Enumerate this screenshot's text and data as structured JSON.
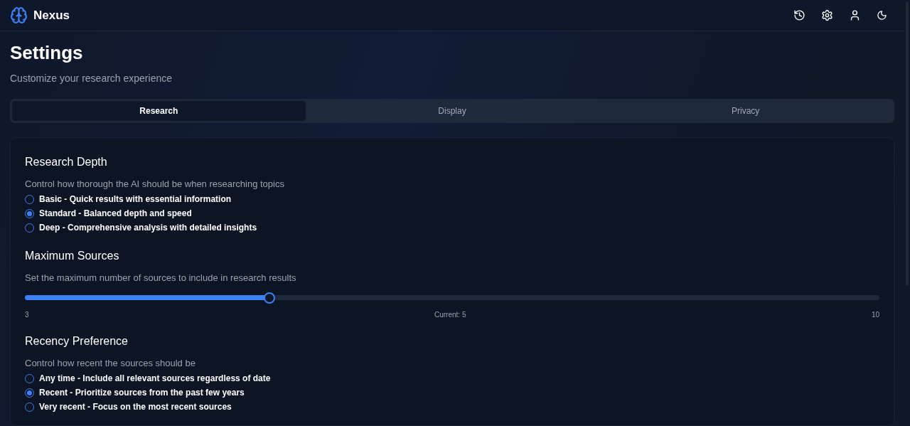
{
  "header": {
    "logo": "Nexus"
  },
  "page": {
    "title": "Settings",
    "subtitle": "Customize your research experience"
  },
  "tabs": [
    {
      "label": "Research",
      "selected": true
    },
    {
      "label": "Display",
      "selected": false
    },
    {
      "label": "Privacy",
      "selected": false
    }
  ],
  "sections": [
    {
      "kind": "radio",
      "title": "Research Depth",
      "description": "Control how thorough the AI should be when researching topics",
      "options": [
        {
          "label": "Basic - Quick results with essential information",
          "selected": false
        },
        {
          "label": "Standard - Balanced depth and speed",
          "selected": true
        },
        {
          "label": "Deep - Comprehensive analysis with detailed insights",
          "selected": false
        }
      ]
    },
    {
      "kind": "slider",
      "title": "Maximum Sources",
      "description": "Set the maximum number of sources to include in research results",
      "level": 0.286,
      "min": "3",
      "reading": "Current: 5",
      "max": "10"
    },
    {
      "kind": "radio",
      "title": "Recency Preference",
      "description": "Control how recent the sources should be",
      "options": [
        {
          "label": "Any time - Include all relevant sources regardless of date",
          "selected": false
        },
        {
          "label": "Recent - Prioritize sources from the past few years",
          "selected": true
        },
        {
          "label": "Very recent - Focus on the most recent sources",
          "selected": false
        }
      ]
    }
  ]
}
